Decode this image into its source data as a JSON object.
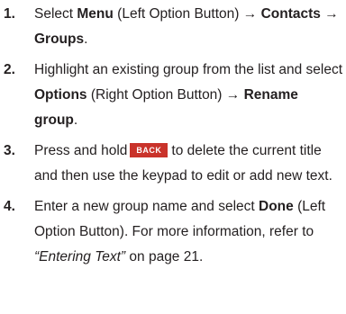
{
  "steps": [
    {
      "number": "1.",
      "t1": "Select ",
      "b1": "Menu",
      "t2": " (Left Option Button) → ",
      "b2": "Contacts",
      "t3": " → ",
      "b3": "Groups",
      "t4": "."
    },
    {
      "number": "2.",
      "t1": "Highlight an existing group from the list and select ",
      "b1": "Options",
      "t2": " (Right Option Button) → ",
      "b2": "Rename group",
      "t3": "."
    },
    {
      "number": "3.",
      "t1": "Press and hold",
      "key": "BACK",
      "t2": "to delete the current title and then use the keypad to edit or add new text."
    },
    {
      "number": "4.",
      "t1": "Enter a new group name and select ",
      "b1": "Done",
      "t2": " (Left Option Button). For more information, refer to ",
      "ref": "“Entering Text”",
      "t3": "  on page 21."
    }
  ]
}
